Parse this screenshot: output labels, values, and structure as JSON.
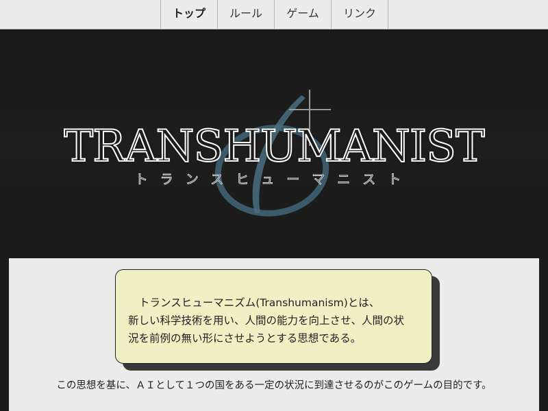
{
  "nav": {
    "items": [
      {
        "label": "トップ"
      },
      {
        "label": "ルール"
      },
      {
        "label": "ゲーム"
      },
      {
        "label": "リンク"
      }
    ]
  },
  "hero": {
    "title": "TRANSHUMANIST",
    "kana": "トランスヒューマニスト",
    "emblem_color": "#3f6273"
  },
  "intro": {
    "line1": "トランスヒューマニズム(Transhumanism)とは、",
    "line2": "新しい科学技術を用い、人間の能力を向上させ、人間の状",
    "line3": "況を前例の無い形にさせようとする思想である。"
  },
  "purpose": "この思想を基に、ＡＩとして１つの国をある一定の状況に到達させるのがこのゲームの目的です。"
}
